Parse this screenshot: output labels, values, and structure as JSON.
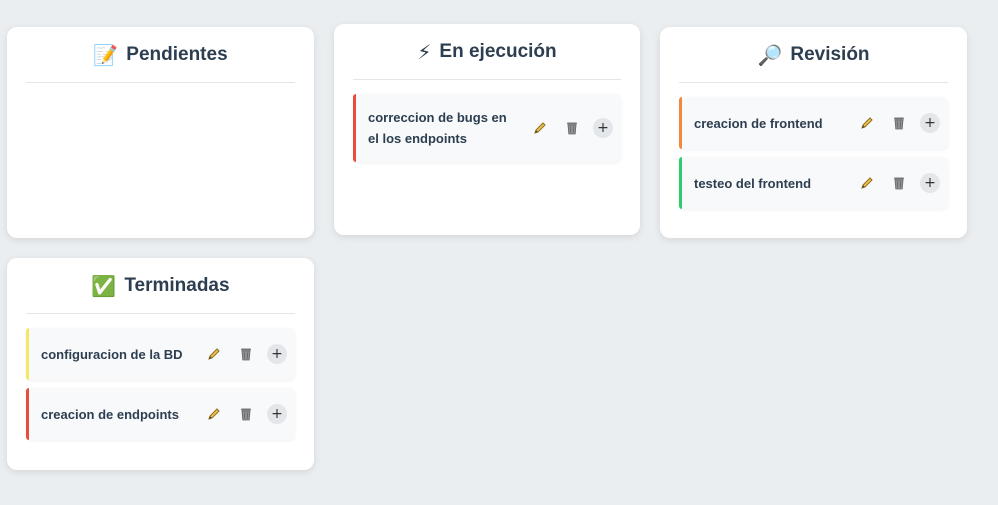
{
  "columns": [
    {
      "title": "Pendientes",
      "icon": "memo-icon",
      "emoji": "📝",
      "tasks": []
    },
    {
      "title": "En ejecución",
      "icon": "lightning-icon",
      "emoji": "⚡",
      "tasks": [
        {
          "text": "correccion de bugs en el los endpoints",
          "color": "#e74c3c"
        }
      ]
    },
    {
      "title": "Revisión",
      "icon": "magnifier-icon",
      "emoji": "🔎",
      "tasks": [
        {
          "text": "creacion de frontend",
          "color": "#f0883e"
        },
        {
          "text": "testeo del frontend",
          "color": "#2ecc71"
        }
      ]
    },
    {
      "title": "Terminadas",
      "icon": "check-icon",
      "emoji": "✅",
      "tasks": [
        {
          "text": "configuracion de la BD",
          "color": "#f5e663"
        },
        {
          "text": "creacion de endpoints",
          "color": "#e74c3c"
        }
      ]
    }
  ],
  "task_actions": {
    "add_label": "+"
  }
}
